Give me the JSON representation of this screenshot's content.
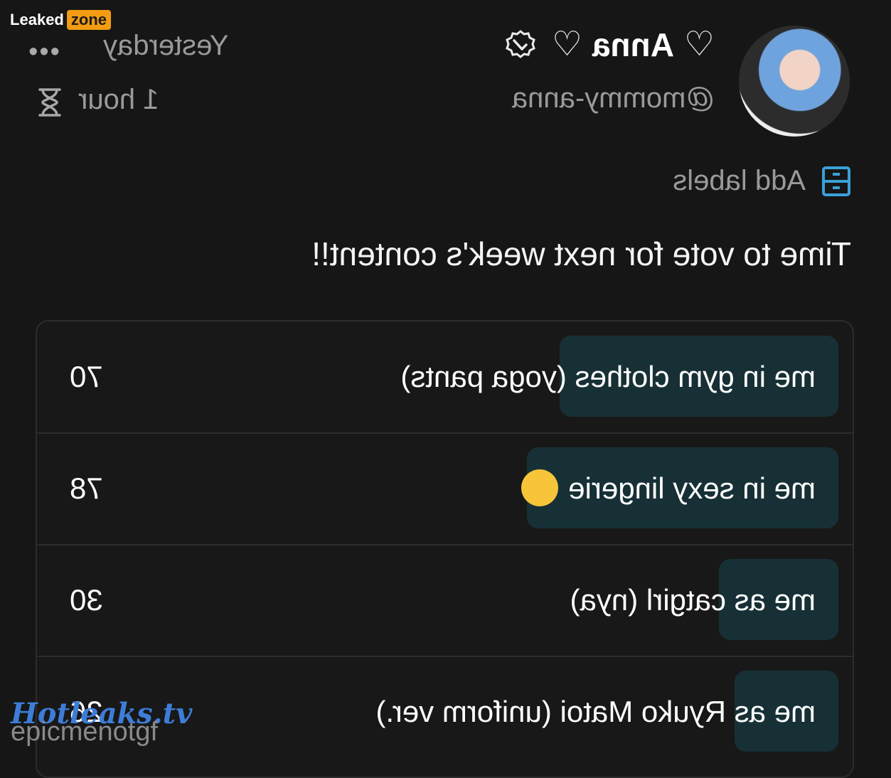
{
  "watermark_top": {
    "text": "Leaked",
    "pill": "zone"
  },
  "author": {
    "name": "Anna",
    "handle": "@mommy-anna",
    "heart_left": "♡",
    "heart_right": "♡"
  },
  "meta": {
    "date": "Yesterday",
    "more": "•••",
    "expires": "1 hour"
  },
  "labels": {
    "text": "Add labels"
  },
  "post": {
    "text": "Time to vote for next week's content!!"
  },
  "poll": {
    "options": [
      {
        "label": "me in gym clothes (yoga pants)",
        "count": "70",
        "share": 0.34
      },
      {
        "label": "me in sexy lingerie",
        "count": "78",
        "share": 0.38
      },
      {
        "label": "me as catgirl (nya)",
        "count": "30",
        "share": 0.15
      },
      {
        "label": "me as Ryuko Matoi (uniform ver.)",
        "count": "26",
        "share": 0.13
      }
    ]
  },
  "watermark_bottom": {
    "text": "Hotleaks.tv",
    "under": "epicmenotgf"
  },
  "colors": {
    "accent": "#3aa0d8",
    "poll_fill": "#173036",
    "badge": "#f39c12"
  }
}
